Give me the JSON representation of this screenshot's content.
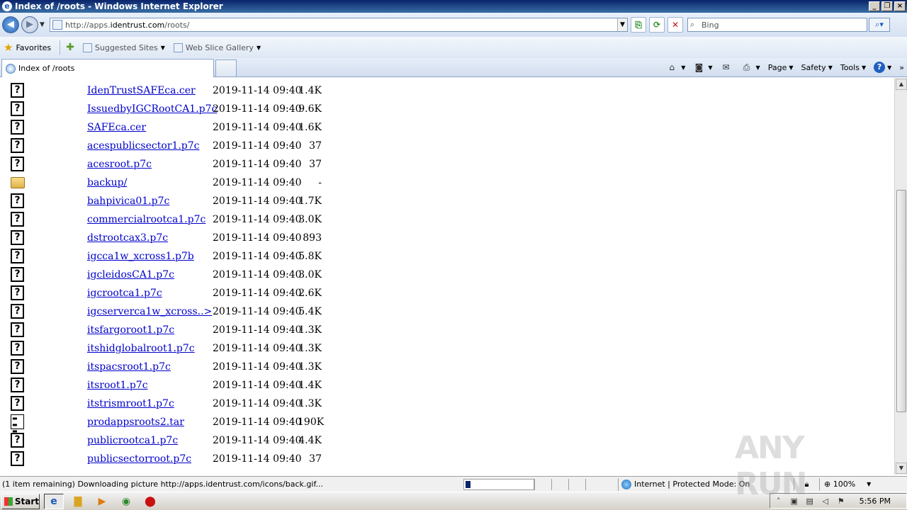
{
  "window": {
    "title": "Index of /roots - Windows Internet Explorer"
  },
  "nav": {
    "url_prefix": "http://apps.",
    "url_domain": "identrust.com",
    "url_path": "/roots/",
    "search_placeholder": "Bing"
  },
  "favorites": {
    "label": "Favorites",
    "items": [
      {
        "label": "Suggested Sites"
      },
      {
        "label": "Web Slice Gallery"
      }
    ]
  },
  "tabs": [
    {
      "label": "Index of /roots"
    }
  ],
  "command_bar": {
    "page": "Page",
    "safety": "Safety",
    "tools": "Tools"
  },
  "listing": [
    {
      "icon": "unknown",
      "name": "IdenTrustSAFEca.cer",
      "date": "2019-11-14 09:40",
      "size": "1.4K"
    },
    {
      "icon": "unknown",
      "name": "IssuedbyIGCRootCA1.p7c",
      "date": "2019-11-14 09:40",
      "size": "9.6K"
    },
    {
      "icon": "unknown",
      "name": "SAFEca.cer",
      "date": "2019-11-14 09:40",
      "size": "1.6K"
    },
    {
      "icon": "unknown",
      "name": "acespublicsector1.p7c",
      "date": "2019-11-14 09:40",
      "size": "37"
    },
    {
      "icon": "unknown",
      "name": "acesroot.p7c",
      "date": "2019-11-14 09:40",
      "size": "37"
    },
    {
      "icon": "folder",
      "name": "backup/",
      "date": "2019-11-14 09:40",
      "size": "-"
    },
    {
      "icon": "unknown",
      "name": "bahpivica01.p7c",
      "date": "2019-11-14 09:40",
      "size": "1.7K"
    },
    {
      "icon": "unknown",
      "name": "commercialrootca1.p7c",
      "date": "2019-11-14 09:40",
      "size": "3.0K"
    },
    {
      "icon": "unknown",
      "name": "dstrootcax3.p7c",
      "date": "2019-11-14 09:40",
      "size": "893"
    },
    {
      "icon": "unknown",
      "name": "igcca1w_xcross1.p7b",
      "date": "2019-11-14 09:40",
      "size": "5.8K"
    },
    {
      "icon": "unknown",
      "name": "igcleidosCA1.p7c",
      "date": "2019-11-14 09:40",
      "size": "3.0K"
    },
    {
      "icon": "unknown",
      "name": "igcrootca1.p7c",
      "date": "2019-11-14 09:40",
      "size": "2.6K"
    },
    {
      "icon": "unknown",
      "name": "igcserverca1w_xcross..>",
      "date": "2019-11-14 09:40",
      "size": "5.4K"
    },
    {
      "icon": "unknown",
      "name": "itsfargoroot1.p7c",
      "date": "2019-11-14 09:40",
      "size": "1.3K"
    },
    {
      "icon": "unknown",
      "name": "itshidglobalroot1.p7c",
      "date": "2019-11-14 09:40",
      "size": "1.3K"
    },
    {
      "icon": "unknown",
      "name": "itspacsroot1.p7c",
      "date": "2019-11-14 09:40",
      "size": "1.3K"
    },
    {
      "icon": "unknown",
      "name": "itsroot1.p7c",
      "date": "2019-11-14 09:40",
      "size": "1.4K"
    },
    {
      "icon": "unknown",
      "name": "itstrismroot1.p7c",
      "date": "2019-11-14 09:40",
      "size": "1.3K"
    },
    {
      "icon": "archive",
      "name": "prodappsroots2.tar",
      "date": "2019-11-14 09:40",
      "size": "190K"
    },
    {
      "icon": "unknown",
      "name": "publicrootca1.p7c",
      "date": "2019-11-14 09:40",
      "size": "4.4K"
    },
    {
      "icon": "unknown",
      "name": "publicsectorroot.p7c",
      "date": "2019-11-14 09:40",
      "size": "37"
    }
  ],
  "status": {
    "text": "(1 item remaining) Downloading picture http://apps.identrust.com/icons/back.gif...",
    "zone": "Internet | Protected Mode: On",
    "zoom": "100%",
    "progress_fraction": 0.07
  },
  "taskbar": {
    "start": "Start",
    "clock": "5:56 PM"
  },
  "watermark": "ANY RUN"
}
